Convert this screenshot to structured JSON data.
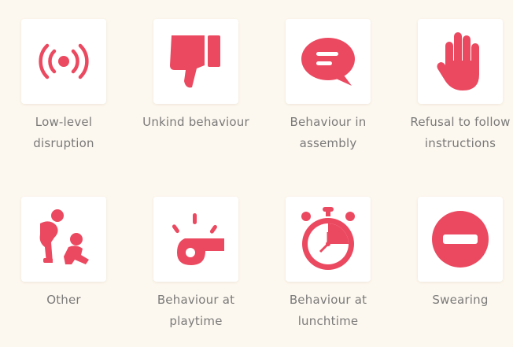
{
  "accent_color": "#eb4960",
  "categories": [
    {
      "label": "Low-level disruption",
      "icon": "signal-broadcast-icon"
    },
    {
      "label": "Unkind behaviour",
      "icon": "thumbs-down-icon"
    },
    {
      "label": "Behaviour in assembly",
      "icon": "speech-bubble-icon"
    },
    {
      "label": "Refusal to follow instructions",
      "icon": "raised-hand-icon"
    },
    {
      "label": "Other",
      "icon": "people-sitting-icon"
    },
    {
      "label": "Behaviour at playtime",
      "icon": "whistle-icon"
    },
    {
      "label": "Behaviour at lunchtime",
      "icon": "stopwatch-icon"
    },
    {
      "label": "Swearing",
      "icon": "no-entry-icon"
    }
  ]
}
